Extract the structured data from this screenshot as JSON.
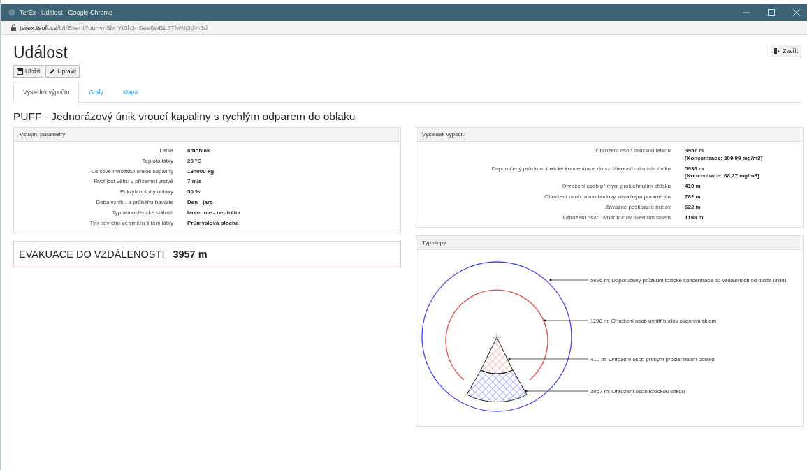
{
  "window": {
    "title": "TerEx - Událost - Google Chrome",
    "url_host": "terex.tsoft.cz",
    "url_path": "/UI/Event?uu=vn5hnYt3h3nSee6wBL3Tlw%3d%3d"
  },
  "page": {
    "title": "Událost",
    "close_button": "Zavřít"
  },
  "toolbar": [
    {
      "kind": "save",
      "label": "Uložit"
    },
    {
      "kind": "edit",
      "label": "Upravit"
    }
  ],
  "tabs": [
    {
      "label": "Výsledek výpočtu",
      "selected": true
    },
    {
      "label": "Grafy",
      "selected": false
    },
    {
      "label": "Mapa",
      "selected": false
    }
  ],
  "scenario_title": "PUFF - Jednorázový únik vroucí kapaliny s rychlým odparem do oblaku",
  "input_panel": {
    "title": "Vstupní parametry",
    "rows": [
      {
        "label": "Látka",
        "value": "amoniak"
      },
      {
        "label": "Teplota látky",
        "value": "20 °C"
      },
      {
        "label": "Celkové množství uniklé kapaliny",
        "value": "134000 kg"
      },
      {
        "label": "Rychlost větru v přízemní vrstvě",
        "value": "7 m/s"
      },
      {
        "label": "Pokrytí oblohy oblaky",
        "value": "50 %"
      },
      {
        "label": "Doba vzniku a průběhu havárie",
        "value": "Den - jaro"
      },
      {
        "label": "Typ atmosférické stálosti",
        "value": "Izotermie - neutrální"
      },
      {
        "label": "Typ povrchu ve směru šíření látky",
        "value": "Průmyslová plocha"
      }
    ]
  },
  "evacuation": {
    "label": "EVAKUACE DO VZDÁLENOSTI",
    "value": "3957 m"
  },
  "result_panel": {
    "title": "Výsledek výpočtu",
    "rows": [
      {
        "label": "Ohrožení osob toxickou látkou",
        "value": "3957 m",
        "note": "[Koncentrace: 209,99 mg/m3]"
      },
      {
        "label": "Doporučený průzkum toxické koncentrace do vzdálenosti od místa úniku",
        "value": "5936 m",
        "note": "[Koncentrace: 68,27 mg/m3]"
      },
      {
        "label": "Ohrožení osob přímým prošlehnutím oblaku",
        "value": "410 m"
      },
      {
        "label": "Ohrožení osob mimo budovy závažným poraněním",
        "value": "782 m"
      },
      {
        "label": "Závažné poškození budov",
        "value": "622 m"
      },
      {
        "label": "Ohrožení osob uvnitř budov okenním sklem",
        "value": "1198 m"
      }
    ]
  },
  "trace_panel": {
    "title": "Typ stopy",
    "labels": [
      "5936 m: Doporučený průzkum toxické koncentrace do vzdálenosti od místa úniku",
      "1198 m: Ohrožení osob uvnitř budov okenním sklem",
      "410 m: Ohrožení osob přímým prošlehnutím oblaku",
      "3957 m: Ohrožení osob toxickou látkou"
    ]
  }
}
